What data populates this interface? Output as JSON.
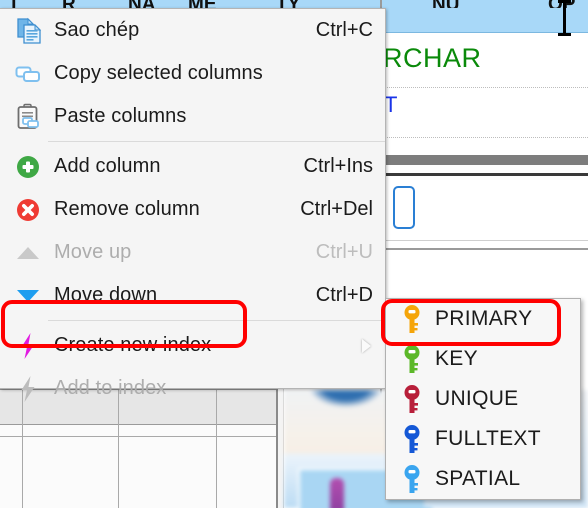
{
  "background": {
    "selected_row_fragments": [
      "T",
      "R",
      "NA",
      "ME",
      "TY",
      "NU",
      "OP"
    ],
    "column_type_text": "RCHAR",
    "blue_cell_text": "T",
    "selection_color": "#a8d8f8",
    "type_text_color": "#0a8a0a",
    "blue_text_color": "#1a34e8"
  },
  "context_menu": {
    "items": [
      {
        "label": "Sao chép",
        "shortcut": "Ctrl+C",
        "icon": "copy-document-icon",
        "disabled": false,
        "submenu": false
      },
      {
        "label": "Copy selected columns",
        "shortcut": "",
        "icon": "copy-columns-icon",
        "disabled": false,
        "submenu": false
      },
      {
        "label": "Paste columns",
        "shortcut": "",
        "icon": "paste-clipboard-icon",
        "disabled": false,
        "submenu": false
      },
      {
        "label": "Add column",
        "shortcut": "Ctrl+Ins",
        "icon": "add-green-plus-icon",
        "disabled": false,
        "submenu": false
      },
      {
        "label": "Remove column",
        "shortcut": "Ctrl+Del",
        "icon": "remove-red-cross-icon",
        "disabled": false,
        "submenu": false
      },
      {
        "label": "Move up",
        "shortcut": "Ctrl+U",
        "icon": "arrow-up-icon",
        "disabled": true,
        "submenu": false
      },
      {
        "label": "Move down",
        "shortcut": "Ctrl+D",
        "icon": "arrow-down-icon",
        "disabled": false,
        "submenu": false
      },
      {
        "label": "Create new index",
        "shortcut": "",
        "icon": "lightning-bolt-icon",
        "disabled": false,
        "submenu": true
      },
      {
        "label": "Add to index",
        "shortcut": "",
        "icon": "lightning-bolt-gray-icon",
        "disabled": true,
        "submenu": false
      }
    ],
    "separator_after_index": [
      2,
      6
    ]
  },
  "submenu": {
    "title": "Create new index",
    "items": [
      {
        "label": "PRIMARY",
        "icon": "key-icon",
        "color": "#f5a50a"
      },
      {
        "label": "KEY",
        "icon": "key-icon",
        "color": "#5cb829"
      },
      {
        "label": "UNIQUE",
        "icon": "key-icon",
        "color": "#b81f3a"
      },
      {
        "label": "FULLTEXT",
        "icon": "key-icon",
        "color": "#1558d6"
      },
      {
        "label": "SPATIAL",
        "icon": "key-icon",
        "color": "#3aa5ef"
      }
    ]
  },
  "annotations": {
    "color": "#ff0000",
    "highlighted": [
      "Create new index",
      "PRIMARY"
    ]
  }
}
